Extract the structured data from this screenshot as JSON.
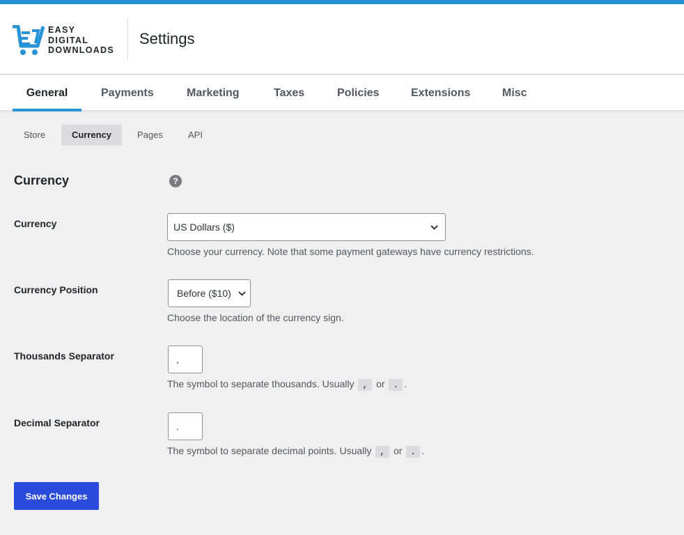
{
  "brand": {
    "line1": "EASY",
    "line2": "DIGITAL",
    "line3": "DOWNLOADS",
    "accent_color": "#2793d6"
  },
  "header": {
    "title": "Settings"
  },
  "tabs": [
    {
      "label": "General",
      "active": true
    },
    {
      "label": "Payments",
      "active": false
    },
    {
      "label": "Marketing",
      "active": false
    },
    {
      "label": "Taxes",
      "active": false
    },
    {
      "label": "Policies",
      "active": false
    },
    {
      "label": "Extensions",
      "active": false
    },
    {
      "label": "Misc",
      "active": false
    }
  ],
  "subtabs": [
    {
      "label": "Store",
      "active": false
    },
    {
      "label": "Currency",
      "active": true
    },
    {
      "label": "Pages",
      "active": false
    },
    {
      "label": "API",
      "active": false
    }
  ],
  "section": {
    "title": "Currency",
    "help_icon": "?"
  },
  "fields": {
    "currency": {
      "label": "Currency",
      "value": "US Dollars ($)",
      "description": "Choose your currency. Note that some payment gateways have currency restrictions."
    },
    "position": {
      "label": "Currency Position",
      "value": "Before ($10)",
      "description": "Choose the location of the currency sign."
    },
    "thousands": {
      "label": "Thousands Separator",
      "value": ",",
      "description_before": "The symbol to separate thousands. Usually",
      "code1": ",",
      "or": "or",
      "code2": ".",
      "period": "."
    },
    "decimal": {
      "label": "Decimal Separator",
      "value": ".",
      "description_before": "The symbol to separate decimal points. Usually",
      "code1": ",",
      "or": "or",
      "code2": ".",
      "period": "."
    }
  },
  "actions": {
    "save_label": "Save Changes",
    "save_color": "#2a4bdc"
  }
}
